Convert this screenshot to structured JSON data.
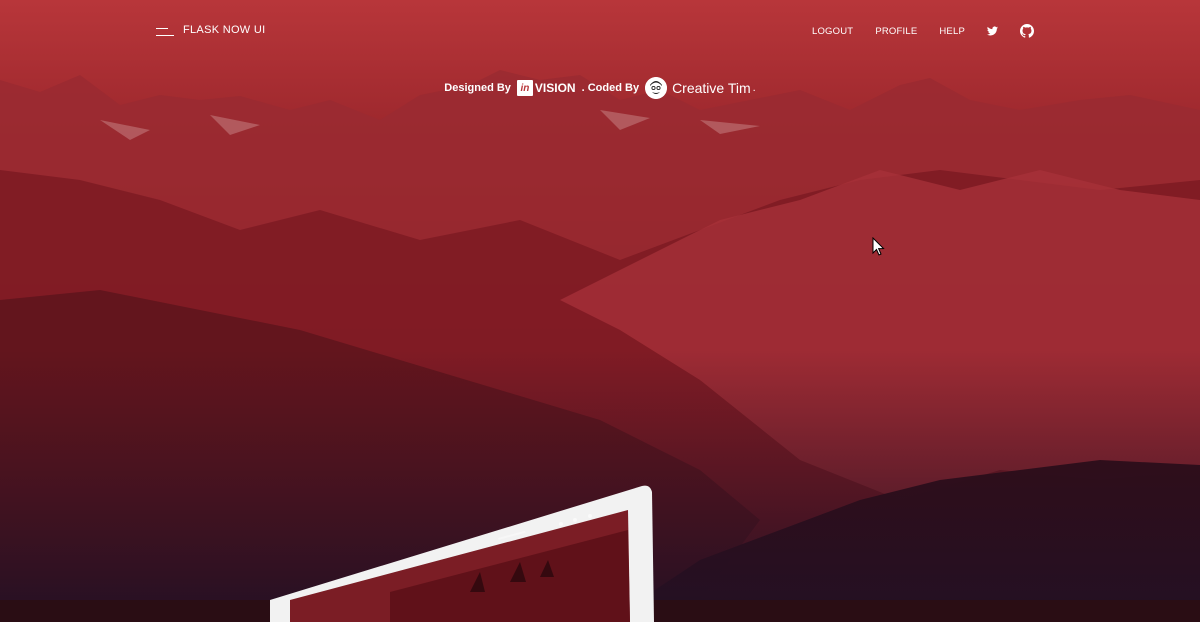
{
  "navbar": {
    "brand": "FLASK NOW UI",
    "links": [
      "LOGOUT",
      "PROFILE",
      "HELP"
    ],
    "icons": [
      "twitter-icon",
      "github-icon"
    ]
  },
  "credits": {
    "designed_by": "Designed By",
    "invision_in": "in",
    "invision_word": "VISION",
    "coded_by": ". Coded By",
    "creative_tim": "Creative Tim",
    "dot": "."
  },
  "colors": {
    "gradient_top": "#b8363a",
    "gradient_bottom": "#2b1023",
    "text": "#ffffff"
  }
}
